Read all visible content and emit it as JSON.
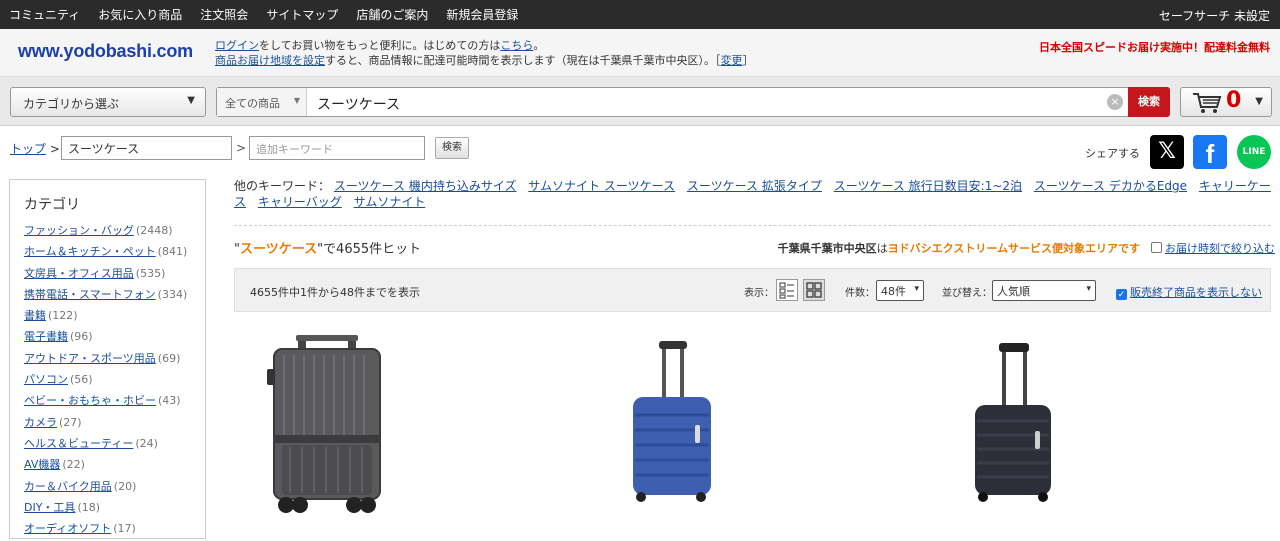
{
  "topnav": {
    "items": [
      "コミュニティ",
      "お気に入り商品",
      "注文照会",
      "サイトマップ",
      "店舗のご案内",
      "新規会員登録"
    ],
    "safesearch": "セーフサーチ 未設定"
  },
  "header": {
    "logo": "www.yodobashi.com",
    "line1_link1": "ログイン",
    "line1_text": "をしてお買い物をもっと便利に。はじめての方は",
    "line1_link2": "こちら",
    "line1_end": "。",
    "line2_link": "商品お届け地域を設定",
    "line2_text": "すると、商品情報に配達可能時間を表示します（現在は千葉県千葉市中央区）。［",
    "line2_change": "変更",
    "line2_end": "］",
    "promo": "日本全国スピードお届け実施中！配達料金無料"
  },
  "search": {
    "category_select": "カテゴリから選ぶ",
    "scope": "全ての商品",
    "query": "スーツケース",
    "button": "検索",
    "cart_count": "0"
  },
  "breadcrumb": {
    "top": "トップ",
    "current": "スーツケース",
    "additional_placeholder": "追加キーワード",
    "kw_button": "検索",
    "share_label": "シェアする",
    "facebook": "f",
    "line": "LINE"
  },
  "sidebar": {
    "title": "カテゴリ",
    "categories": [
      {
        "name": "ファッション・バッグ",
        "count": "(2448)"
      },
      {
        "name": "ホーム＆キッチン・ペット",
        "count": "(841)"
      },
      {
        "name": "文房具・オフィス用品",
        "count": "(535)"
      },
      {
        "name": "携帯電話・スマートフォン",
        "count": "(334)"
      },
      {
        "name": "書籍",
        "count": "(122)"
      },
      {
        "name": "電子書籍",
        "count": "(96)"
      },
      {
        "name": "アウトドア・スポーツ用品",
        "count": "(69)"
      },
      {
        "name": "パソコン",
        "count": "(56)"
      },
      {
        "name": "ベビー・おもちゃ・ホビー",
        "count": "(43)"
      },
      {
        "name": "カメラ",
        "count": "(27)"
      },
      {
        "name": "ヘルス＆ビューティー",
        "count": "(24)"
      },
      {
        "name": "AV機器",
        "count": "(22)"
      },
      {
        "name": "カー＆バイク用品",
        "count": "(20)"
      },
      {
        "name": "DIY・工具",
        "count": "(18)"
      },
      {
        "name": "オーディオソフト",
        "count": "(17)"
      }
    ]
  },
  "main": {
    "other_keywords_label": "他のキーワード：",
    "other_keywords": [
      "スーツケース 機内持ち込みサイズ",
      "サムソナイト スーツケース",
      "スーツケース 拡張タイプ",
      "スーツケース 旅行日数目安:1~2泊",
      "スーツケース デカかるEdge",
      "キャリーケース",
      "キャリーバッグ",
      "サムソナイト"
    ],
    "hits_prefix": "\"",
    "hits_keyword": "スーツケース",
    "hits_suffix": "\"で4655件ヒット",
    "area_pref": "千葉県千葉市中央区",
    "area_mid": "は",
    "area_service": "ヨドバシエクストリームサービス便対象エリアです",
    "area_checkbox": "お届け時刻で絞り込む",
    "range_text": "4655件中1件から48件までを表示",
    "view_label": "表示：",
    "count_label": "件数：",
    "count_value": "48件",
    "sort_label": "並び替え：",
    "sort_value": "人気順",
    "discontinued_label": "販売終了商品を表示しない"
  }
}
